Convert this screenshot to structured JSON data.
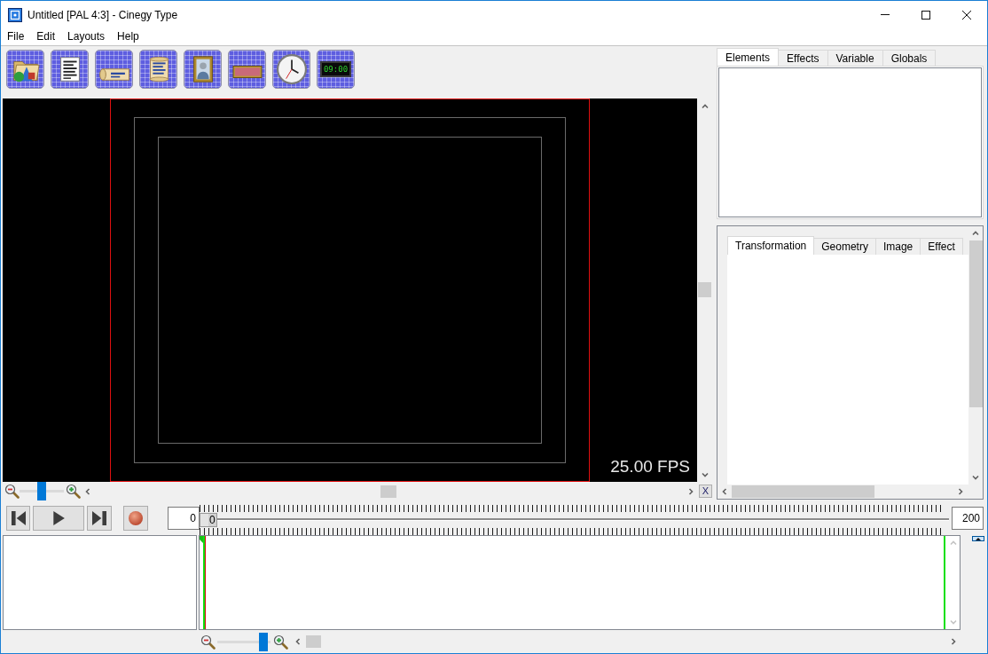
{
  "window": {
    "title": "Untitled [PAL 4:3] - Cinegy Type"
  },
  "menu": [
    "File",
    "Edit",
    "Layouts",
    "Help"
  ],
  "toolbar": [
    {
      "kind": "folder"
    },
    {
      "kind": "document"
    },
    {
      "kind": "scroll"
    },
    {
      "kind": "text-scroll"
    },
    {
      "kind": "picture"
    },
    {
      "kind": "banner"
    },
    {
      "kind": "clock"
    },
    {
      "kind": "digital-clock",
      "text": "09:00"
    }
  ],
  "preview": {
    "fps": "25.00 FPS",
    "zoom": {
      "level": 0.5
    },
    "corner_button": "X"
  },
  "element_tabs": [
    {
      "label": "Elements",
      "selected": true
    },
    {
      "label": "Effects",
      "selected": false
    },
    {
      "label": "Variable",
      "selected": false
    },
    {
      "label": "Globals",
      "selected": false
    }
  ],
  "property_tabs": [
    {
      "label": "Transformation",
      "selected": true
    },
    {
      "label": "Geometry",
      "selected": false
    },
    {
      "label": "Image",
      "selected": false
    },
    {
      "label": "Effect",
      "selected": false
    }
  ],
  "transport": {
    "frame": "0",
    "slider": {
      "label": "0",
      "level": 0
    },
    "end": "200"
  },
  "timeline": {
    "zoom": {
      "level": 0.94
    }
  }
}
